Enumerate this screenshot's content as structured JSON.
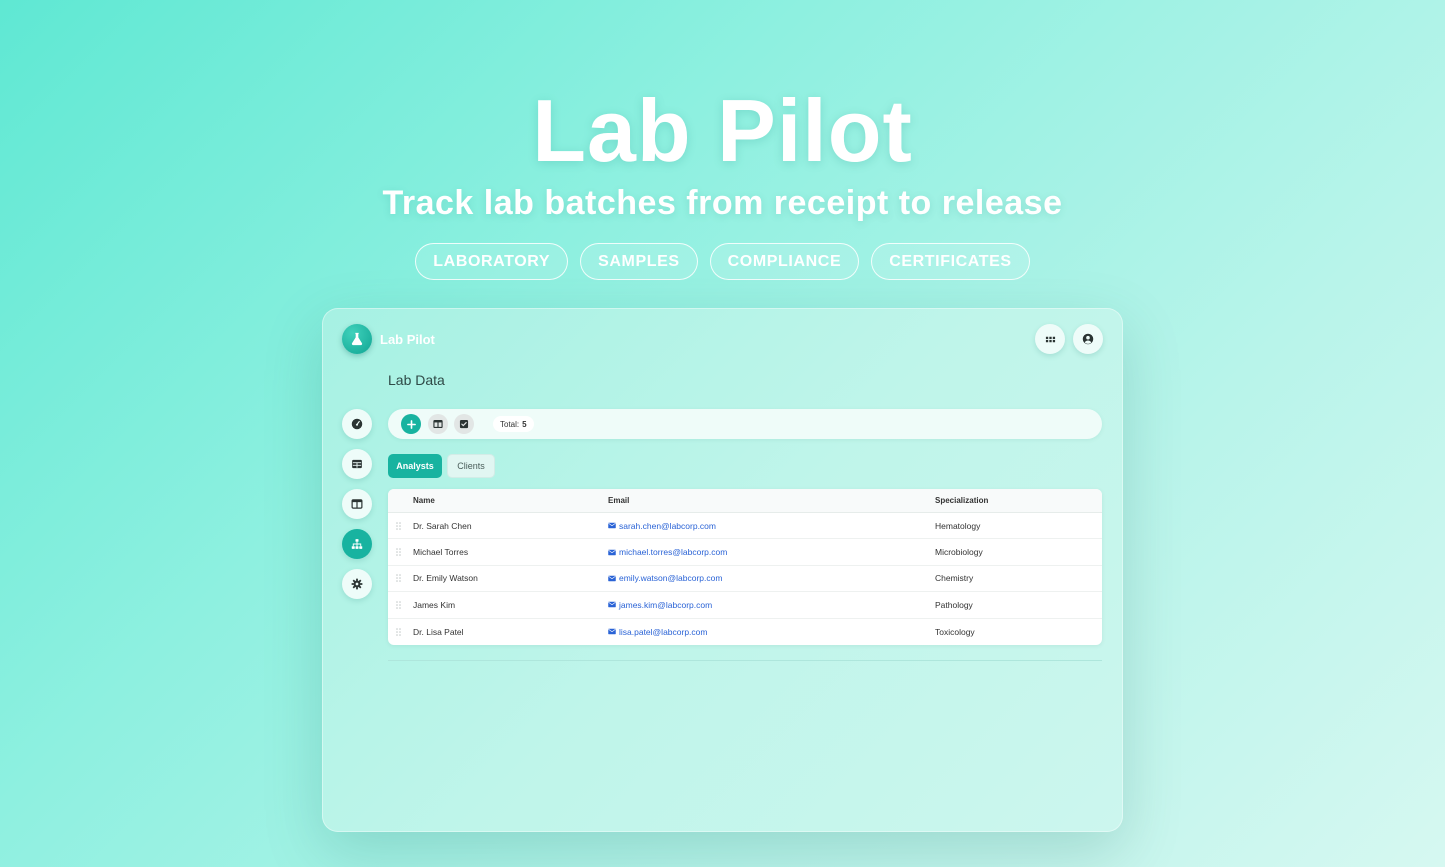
{
  "hero": {
    "title": "Lab Pilot",
    "subtitle": "Track lab batches from receipt to release",
    "tags": [
      "LABORATORY",
      "SAMPLES",
      "COMPLIANCE",
      "CERTIFICATES"
    ]
  },
  "app": {
    "brand": "Lab Pilot",
    "page_title": "Lab Data",
    "toolbar": {
      "total_label": "Total:",
      "total_value": "5"
    },
    "tabs": [
      {
        "label": "Analysts",
        "active": true
      },
      {
        "label": "Clients",
        "active": false
      }
    ],
    "table": {
      "columns": [
        "Name",
        "Email",
        "Specialization"
      ],
      "rows": [
        {
          "name": "Dr. Sarah Chen",
          "email": "sarah.chen@labcorp.com",
          "specialization": "Hematology"
        },
        {
          "name": "Michael Torres",
          "email": "michael.torres@labcorp.com",
          "specialization": "Microbiology"
        },
        {
          "name": "Dr. Emily Watson",
          "email": "emily.watson@labcorp.com",
          "specialization": "Chemistry"
        },
        {
          "name": "James Kim",
          "email": "james.kim@labcorp.com",
          "specialization": "Pathology"
        },
        {
          "name": "Dr. Lisa Patel",
          "email": "lisa.patel@labcorp.com",
          "specialization": "Toxicology"
        }
      ]
    },
    "icons": {
      "logo": "flask-icon",
      "apps": "grid-icon",
      "account": "user-circle-icon",
      "sidebar": [
        "dashboard-gauge-icon",
        "table-icon",
        "columns-icon",
        "sitemap-icon",
        "gear-icon"
      ],
      "toolbar": [
        "plus-icon",
        "columns-icon",
        "checkbox-icon"
      ]
    },
    "colors": {
      "accent": "#18b3a0",
      "link": "#2a63d6"
    }
  }
}
